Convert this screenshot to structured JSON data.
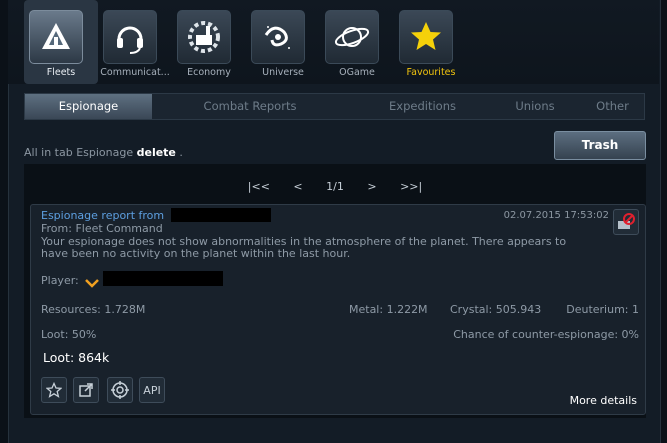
{
  "nav": [
    {
      "label": "Fleets",
      "icon": "fleets-icon"
    },
    {
      "label": "Communicat...",
      "icon": "headset-icon"
    },
    {
      "label": "Economy",
      "icon": "factory-icon"
    },
    {
      "label": "Universe",
      "icon": "galaxy-icon"
    },
    {
      "label": "OGame",
      "icon": "planet-icon"
    },
    {
      "label": "Favourites",
      "icon": "star-icon"
    }
  ],
  "tabs": [
    "Espionage",
    "Combat Reports",
    "Expeditions",
    "Unions",
    "Other"
  ],
  "info": {
    "prefix": "All in tab Espionage",
    "action": "delete",
    "suffix": "."
  },
  "trash_label": "Trash",
  "pager": {
    "first": "|<<",
    "prev": "<",
    "page": "1/1",
    "next": ">",
    "last": ">>|"
  },
  "report": {
    "title": "Espionage report from",
    "date": "02.07.2015 17:53:02",
    "from": "From: Fleet Command",
    "text1": "Your espionage does not show abnormalities in the atmosphere of the planet. There appears to",
    "text2": "have been no activity on the planet within the last hour.",
    "player_label": "Player:",
    "resources": "Resources: 1.728M",
    "metal": "Metal: 1.222M",
    "crystal": "Crystal: 505.943",
    "deuterium": "Deuterium: 1",
    "loot_pct": "Loot: 50%",
    "counter": "Chance of counter-espionage: 0%",
    "loot_total": "Loot: 864k",
    "api_label": "API",
    "more": "More details"
  }
}
